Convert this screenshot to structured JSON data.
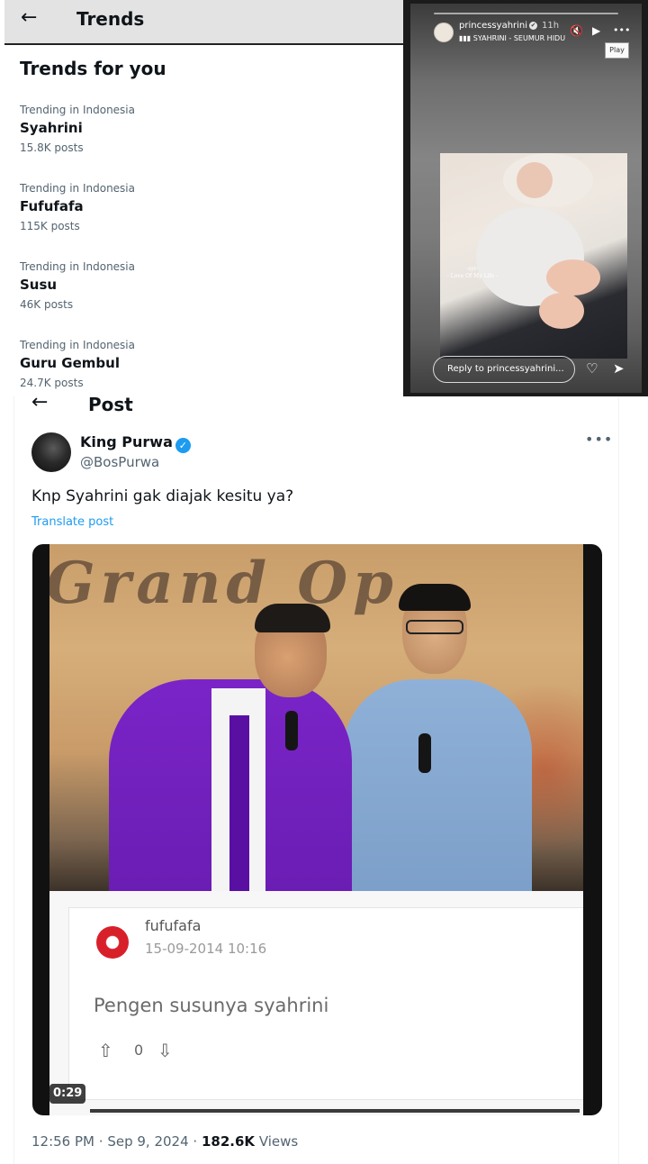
{
  "trends": {
    "back_icon": "arrow-left-icon",
    "header_title": "Trends",
    "section_title": "Trends for you",
    "items": [
      {
        "meta": "Trending in Indonesia",
        "name": "Syahrini",
        "count": "15.8K posts"
      },
      {
        "meta": "Trending in Indonesia",
        "name": "Fufufafa",
        "count": "115K posts"
      },
      {
        "meta": "Trending in Indonesia",
        "name": "Susu",
        "count": "46K posts"
      },
      {
        "meta": "Trending in Indonesia",
        "name": "Guru Gembul",
        "count": "24.7K posts"
      }
    ]
  },
  "story": {
    "username": "princessyahrini",
    "verified_icon": "✔",
    "time": "11h",
    "song": "SYAHRINI - SEUMUR HIDUP",
    "music_icon": "▮▮▮",
    "mute_icon": "🔇",
    "play_icon": "▶",
    "more_icon": "•••",
    "play_tooltip": "Play",
    "photo_caption_line1": "-syr-",
    "photo_caption_line2": "- Love Of My Life -",
    "reply_placeholder": "Reply to princessyahrini...",
    "heart_icon": "♡",
    "send_icon": "➤"
  },
  "post": {
    "title": "Post",
    "author_name": "King Purwa",
    "verified_icon": "✓",
    "author_handle": "@BosPurwa",
    "more_icon": "•••",
    "text": "Knp Syahrini gak diajak kesitu ya?",
    "translate_label": "Translate post",
    "video": {
      "sign_text": "Grand Op",
      "duration": "0:29",
      "comment": {
        "username": "fufufafa",
        "date": "15-09-2014 10:16",
        "text": "Pengen susunya syahrini",
        "vote_count": "0",
        "up_icon": "⇧",
        "down_icon": "⇩"
      }
    },
    "time": "12:56 PM",
    "date": "Sep 9, 2024",
    "views_count": "182.6K",
    "views_label": "Views",
    "separator": "·"
  },
  "colors": {
    "link_blue": "#1d9bf0",
    "muted_text": "#536471",
    "suit_purple": "#7a24c8",
    "fufufafa_red": "#d8202a"
  }
}
